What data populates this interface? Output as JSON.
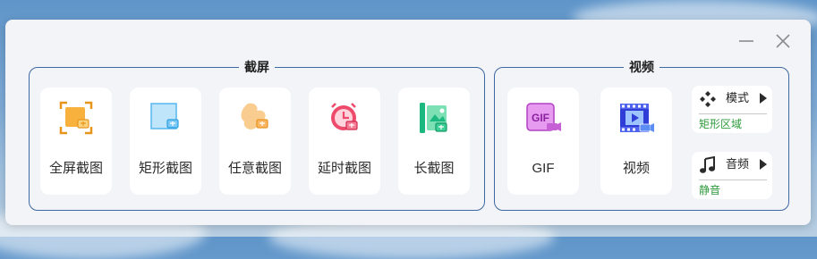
{
  "window": {
    "minimize_icon": "minimize-icon",
    "close_icon": "close-icon"
  },
  "screenshot_group": {
    "title": "截屏",
    "tiles": [
      {
        "label": "全屏截图",
        "icon": "fullscreen-capture-icon"
      },
      {
        "label": "矩形截图",
        "icon": "rectangle-capture-icon"
      },
      {
        "label": "任意截图",
        "icon": "freeform-capture-icon"
      },
      {
        "label": "延时截图",
        "icon": "delayed-capture-icon"
      },
      {
        "label": "长截图",
        "icon": "long-capture-icon"
      }
    ]
  },
  "video_group": {
    "title": "视频",
    "tiles": [
      {
        "label": "GIF",
        "icon": "gif-icon",
        "icon_text": "GIF"
      },
      {
        "label": "视频",
        "icon": "video-film-icon"
      }
    ],
    "mode": {
      "label": "模式",
      "value": "矩形区域",
      "icon": "mode-diamond-icon"
    },
    "audio": {
      "label": "音频",
      "value": "静音",
      "icon": "music-note-icon"
    }
  },
  "colors": {
    "border": "#3d68a1",
    "accent_green": "#2e9a3c",
    "panel_bg": "#f3f4f8"
  }
}
